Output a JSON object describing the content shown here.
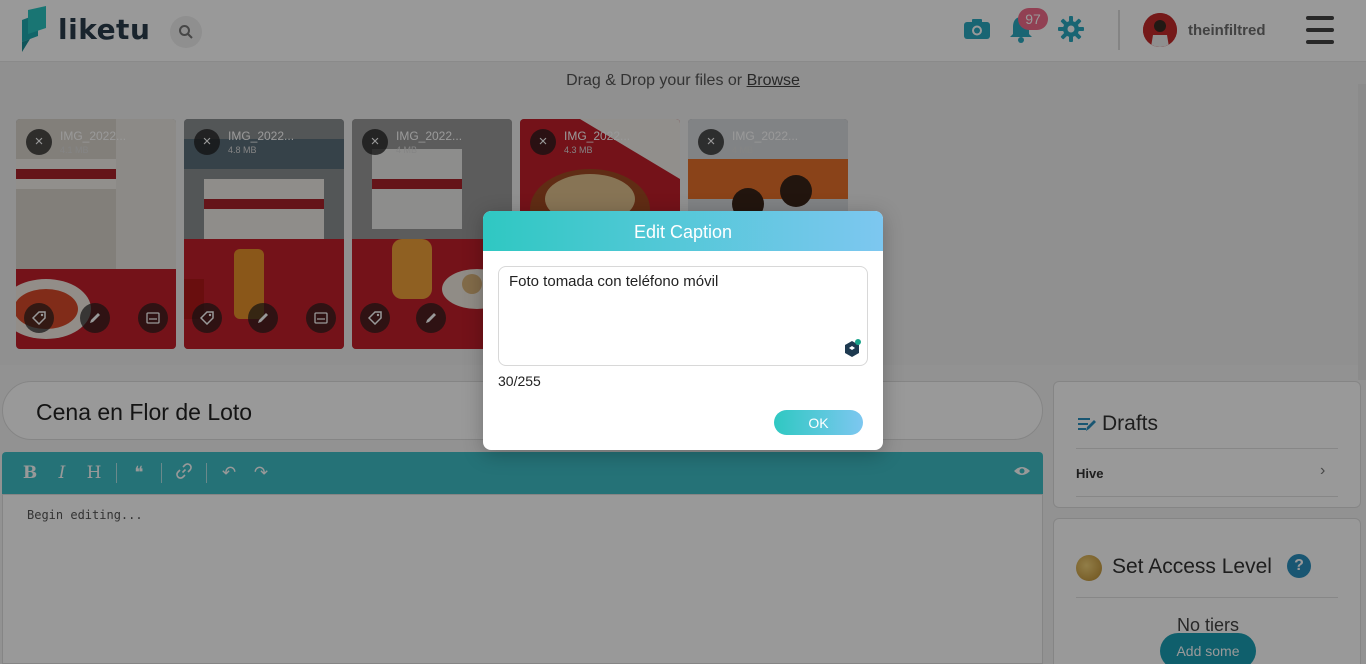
{
  "header": {
    "logo_text": "liketu",
    "notification_count": "97",
    "username": "theinfiltred"
  },
  "upload": {
    "drag_text": "Drag & Drop your files or ",
    "browse_label": "Browse",
    "files": [
      {
        "name": "IMG_2022...",
        "size": "4.1 MB"
      },
      {
        "name": "IMG_2022...",
        "size": "4.8 MB"
      },
      {
        "name": "IMG_2022...",
        "size": "4 MB"
      },
      {
        "name": "IMG_2022...",
        "size": "4.3 MB"
      },
      {
        "name": "IMG_2022...",
        "size": "4 MB"
      }
    ],
    "close_glyph": "×"
  },
  "post": {
    "title": "Cena en Flor de Loto",
    "editor_placeholder": "Begin editing..."
  },
  "toolbar": {
    "bold": "B",
    "italic": "I",
    "heading": "H",
    "quote": "❝",
    "undo": "↶",
    "redo": "↷"
  },
  "sidebar": {
    "drafts_title": "Drafts",
    "drafts_item": "Hive",
    "drafts_chevron": "›",
    "access_title": "Set Access Level",
    "help": "?",
    "no_tiers": "No tiers",
    "add_some": "Add some"
  },
  "modal": {
    "title": "Edit Caption",
    "caption": "Foto tomada con teléfono móvil",
    "counter": "30/255",
    "ok_label": "OK"
  },
  "colors": {
    "accent": "#3fbfc6",
    "gradient_start": "#2fc8c2",
    "gradient_end": "#7dc7f0",
    "badge": "#f26b8a",
    "brand_dark": "#2a3c4c"
  }
}
